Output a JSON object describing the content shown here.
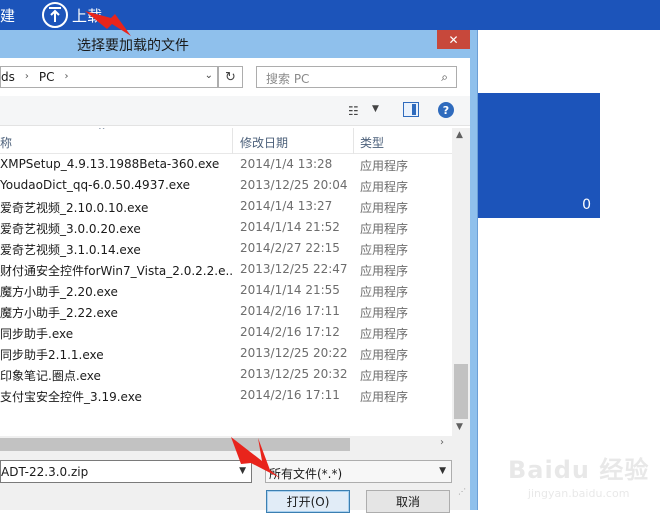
{
  "appbar": {
    "new_label": "建",
    "upload_label": "上载"
  },
  "background": {
    "count": "0"
  },
  "dialog": {
    "title": "选择要加载的文件",
    "close_glyph": "✕",
    "address": {
      "crumbs": [
        "ds",
        "PC"
      ]
    },
    "search": {
      "placeholder": "搜索 PC"
    },
    "columns": {
      "name": "称",
      "date": "修改日期",
      "type": "类型"
    },
    "files": [
      {
        "name": "XMPSetup_4.9.13.1988Beta-360.exe",
        "date": "2014/1/4 13:28",
        "type": "应用程序"
      },
      {
        "name": "YoudaoDict_qq-6.0.50.4937.exe",
        "date": "2013/12/25 20:04",
        "type": "应用程序"
      },
      {
        "name": "爱奇艺视频_2.10.0.10.exe",
        "date": "2014/1/4 13:27",
        "type": "应用程序"
      },
      {
        "name": "爱奇艺视频_3.0.0.20.exe",
        "date": "2014/1/14 21:52",
        "type": "应用程序"
      },
      {
        "name": "爱奇艺视频_3.1.0.14.exe",
        "date": "2014/2/27 22:15",
        "type": "应用程序"
      },
      {
        "name": "财付通安全控件forWin7_Vista_2.0.2.2.e...",
        "date": "2013/12/25 22:47",
        "type": "应用程序"
      },
      {
        "name": "魔方小助手_2.20.exe",
        "date": "2014/1/14 21:55",
        "type": "应用程序"
      },
      {
        "name": "魔方小助手_2.22.exe",
        "date": "2014/2/16 17:11",
        "type": "应用程序"
      },
      {
        "name": "同步助手.exe",
        "date": "2014/2/16 17:12",
        "type": "应用程序"
      },
      {
        "name": "同步助手2.1.1.exe",
        "date": "2013/12/25 20:22",
        "type": "应用程序"
      },
      {
        "name": "印象笔记.圈点.exe",
        "date": "2013/12/25 20:32",
        "type": "应用程序"
      },
      {
        "name": "支付宝安全控件_3.19.exe",
        "date": "2014/2/16 17:11",
        "type": "应用程序"
      }
    ],
    "filename_value": "ADT-22.3.0.zip",
    "filetype_value": "所有文件(*.*)",
    "open_label": "打开(O)",
    "cancel_label": "取消"
  },
  "watermark": {
    "logo": "Baidu 经验",
    "site": "jingyan.baidu.com"
  },
  "colors": {
    "appbar": "#1c54ba",
    "dialog_frame": "#8fc0ec",
    "close": "#c7483b",
    "annotation": "#e8241c"
  }
}
